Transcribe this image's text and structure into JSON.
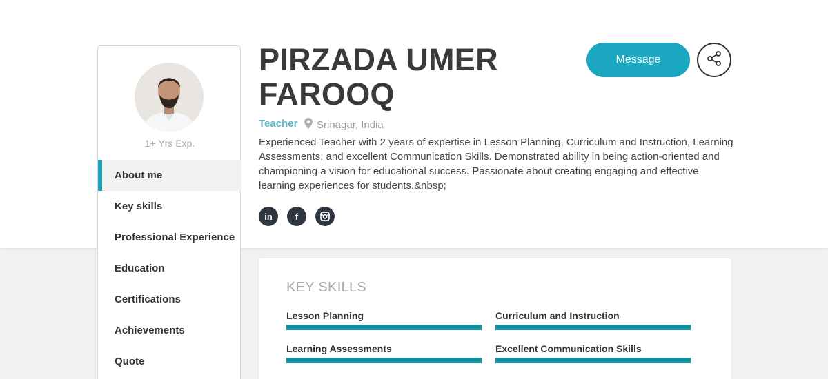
{
  "profile": {
    "name": "PIRZADA UMER FAROOQ",
    "role": "Teacher",
    "location": "Srinagar, India",
    "experience": "1+ Yrs Exp.",
    "about": "Experienced Teacher with 2 years of expertise in Lesson Planning, Curriculum and Instruction, Learning Assessments, and excellent Communication Skills. Demonstrated ability in being action-oriented and championing a vision for educational success. Passionate about creating engaging and effective learning experiences for students.&nbsp;"
  },
  "actions": {
    "message_label": "Message",
    "share_icon": "share-icon"
  },
  "social": [
    {
      "name": "linkedin",
      "glyph": "in"
    },
    {
      "name": "facebook",
      "glyph": "f"
    },
    {
      "name": "instagram",
      "glyph": "◎"
    }
  ],
  "nav": {
    "items": [
      {
        "label": "About me",
        "active": true
      },
      {
        "label": "Key skills"
      },
      {
        "label": "Professional Experience"
      },
      {
        "label": "Education"
      },
      {
        "label": "Certifications"
      },
      {
        "label": "Achievements"
      },
      {
        "label": "Quote"
      }
    ]
  },
  "key_skills": {
    "title": "KEY SKILLS",
    "items": [
      {
        "label": "Lesson Planning",
        "level": 1.0
      },
      {
        "label": "Curriculum and Instruction",
        "level": 1.0
      },
      {
        "label": "Learning Assessments",
        "level": 1.0
      },
      {
        "label": "Excellent Communication Skills",
        "level": 1.0
      }
    ]
  },
  "colors": {
    "accent": "#1ba7bf",
    "nav_indicator": "#1ba2b5",
    "dark": "#2f3640"
  }
}
